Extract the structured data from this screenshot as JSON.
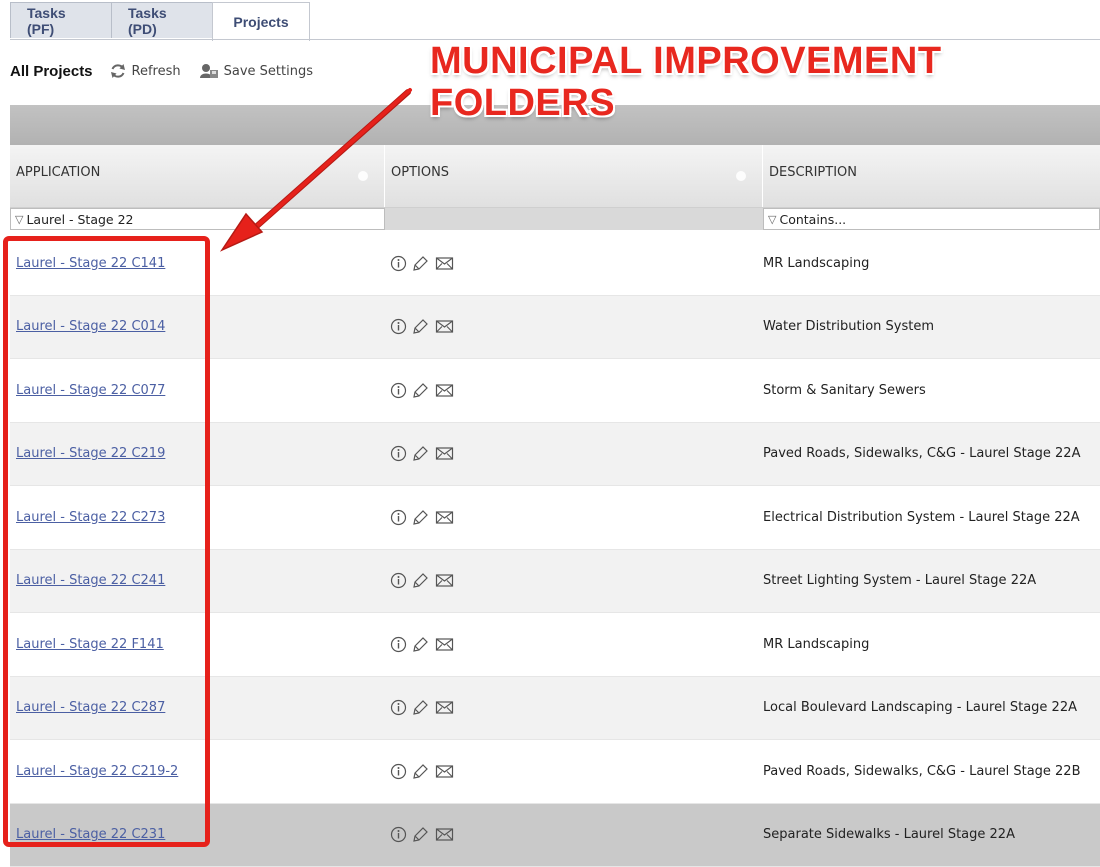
{
  "tabs": [
    {
      "label": "Tasks (PF)"
    },
    {
      "label": "Tasks (PD)"
    },
    {
      "label": "Projects"
    }
  ],
  "toolbar": {
    "title": "All Projects",
    "refresh_label": "Refresh",
    "save_label": "Save Settings"
  },
  "annotation": {
    "line1": "MUNICIPAL IMPROVEMENT",
    "line2": "FOLDERS",
    "color": "#e8281f"
  },
  "grid": {
    "columns": [
      "APPLICATION",
      "OPTIONS",
      "DESCRIPTION"
    ],
    "filters": {
      "application": "Laurel - Stage 22",
      "description_placeholder": "Contains..."
    },
    "rows": [
      {
        "application": "Laurel - Stage 22 C141",
        "description": "MR Landscaping"
      },
      {
        "application": "Laurel - Stage 22 C014",
        "description": "Water Distribution System"
      },
      {
        "application": "Laurel - Stage 22 C077",
        "description": "Storm & Sanitary Sewers"
      },
      {
        "application": "Laurel - Stage 22 C219",
        "description": "Paved Roads, Sidewalks, C&G - Laurel Stage 22A"
      },
      {
        "application": "Laurel - Stage 22 C273",
        "description": "Electrical Distribution System - Laurel Stage 22A"
      },
      {
        "application": "Laurel - Stage 22 C241",
        "description": "Street Lighting System - Laurel Stage 22A"
      },
      {
        "application": "Laurel - Stage 22 F141",
        "description": "MR Landscaping"
      },
      {
        "application": "Laurel - Stage 22 C287",
        "description": "Local Boulevard Landscaping - Laurel Stage 22A"
      },
      {
        "application": "Laurel - Stage 22 C219-2",
        "description": "Paved Roads, Sidewalks, C&G - Laurel Stage 22B"
      },
      {
        "application": "Laurel - Stage 22 C231",
        "description": "Separate Sidewalks - Laurel Stage 22A"
      }
    ],
    "option_icons": [
      "info-icon",
      "edit-icon",
      "mail-icon"
    ],
    "link_color": "#4b5fa3"
  }
}
